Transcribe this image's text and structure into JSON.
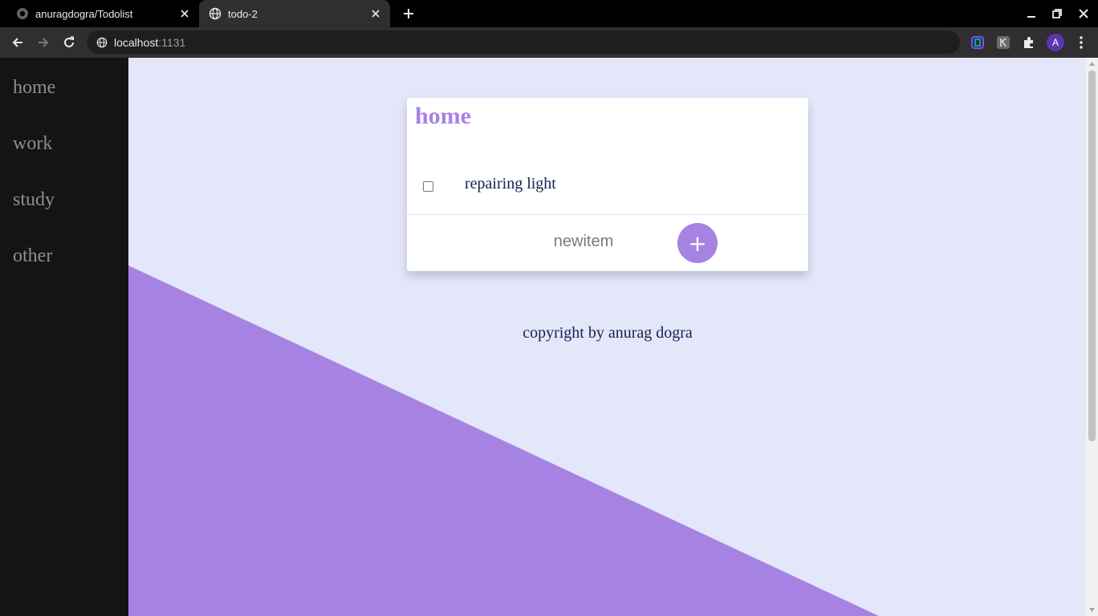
{
  "browser": {
    "tabs": [
      {
        "title": "anuragdogra/Todolist",
        "icon": "github-icon",
        "active": false
      },
      {
        "title": "todo-2",
        "icon": "globe-icon",
        "active": true
      }
    ],
    "url": {
      "host": "localhost",
      "port": ":1131"
    },
    "profile_initial": "A"
  },
  "sidebar": {
    "items": [
      {
        "label": "home"
      },
      {
        "label": "work"
      },
      {
        "label": "study"
      },
      {
        "label": "other"
      }
    ]
  },
  "card": {
    "title": "home",
    "items": [
      {
        "text": "repairing light",
        "checked": false
      }
    ],
    "input": {
      "placeholder": "newitem",
      "value": ""
    },
    "add_label": "+"
  },
  "footer": {
    "text": "copyright by anurag dogra"
  },
  "colors": {
    "accent": "#a683e3",
    "page_bg": "#e3e7f9",
    "sidebar_bg": "#141414",
    "text_dark": "#15224e"
  }
}
